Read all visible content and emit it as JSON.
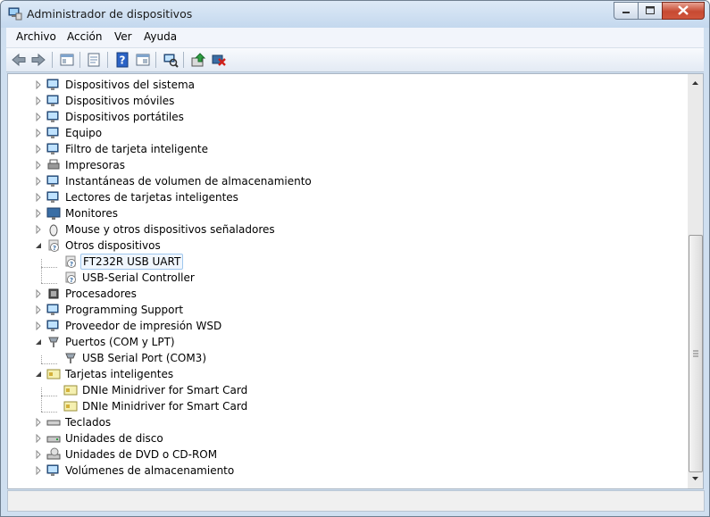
{
  "window": {
    "title": "Administrador de dispositivos"
  },
  "menu": {
    "archivo": "Archivo",
    "accion": "Acción",
    "ver": "Ver",
    "ayuda": "Ayuda"
  },
  "toolbar": {
    "icons": [
      "back-arrow-icon",
      "forward-arrow-icon",
      "show-hide-tree-icon",
      "properties-icon",
      "help-icon",
      "view-icon",
      "scan-hardware-icon",
      "update-driver-icon",
      "uninstall-device-icon"
    ]
  },
  "tree": {
    "items": [
      {
        "label": "Dispositivos del sistema",
        "expanded": false,
        "icon": "system-devices-icon"
      },
      {
        "label": "Dispositivos móviles",
        "expanded": false,
        "icon": "mobile-devices-icon"
      },
      {
        "label": "Dispositivos portátiles",
        "expanded": false,
        "icon": "portable-devices-icon"
      },
      {
        "label": "Equipo",
        "expanded": false,
        "icon": "computer-icon"
      },
      {
        "label": "Filtro de tarjeta inteligente",
        "expanded": false,
        "icon": "smartcard-filter-icon"
      },
      {
        "label": "Impresoras",
        "expanded": false,
        "icon": "printer-icon"
      },
      {
        "label": "Instantáneas de volumen de almacenamiento",
        "expanded": false,
        "icon": "volume-snapshot-icon"
      },
      {
        "label": "Lectores de tarjetas inteligentes",
        "expanded": false,
        "icon": "smartcard-reader-icon"
      },
      {
        "label": "Monitores",
        "expanded": false,
        "icon": "monitor-icon"
      },
      {
        "label": "Mouse y otros dispositivos señaladores",
        "expanded": false,
        "icon": "mouse-icon"
      },
      {
        "label": "Otros dispositivos",
        "expanded": true,
        "icon": "unknown-device-icon"
      },
      {
        "label": "FT232R USB UART",
        "child": true,
        "selected": true,
        "icon": "unknown-device-icon"
      },
      {
        "label": "USB-Serial Controller",
        "child": true,
        "icon": "unknown-device-icon"
      },
      {
        "label": "Procesadores",
        "expanded": false,
        "icon": "processor-icon"
      },
      {
        "label": "Programming Support",
        "expanded": false,
        "icon": "programming-support-icon"
      },
      {
        "label": "Proveedor de impresión WSD",
        "expanded": false,
        "icon": "wsd-printer-icon"
      },
      {
        "label": "Puertos (COM y LPT)",
        "expanded": true,
        "icon": "port-icon"
      },
      {
        "label": "USB Serial Port (COM3)",
        "child": true,
        "icon": "port-icon"
      },
      {
        "label": "Tarjetas inteligentes",
        "expanded": true,
        "icon": "smartcard-icon"
      },
      {
        "label": "DNIe Minidriver for Smart Card",
        "child": true,
        "icon": "smartcard-icon"
      },
      {
        "label": "DNIe Minidriver for Smart Card",
        "child": true,
        "icon": "smartcard-icon"
      },
      {
        "label": "Teclados",
        "expanded": false,
        "icon": "keyboard-icon"
      },
      {
        "label": "Unidades de disco",
        "expanded": false,
        "icon": "disk-drive-icon"
      },
      {
        "label": "Unidades de DVD o CD-ROM",
        "expanded": false,
        "icon": "dvd-drive-icon"
      },
      {
        "label": "Volúmenes de almacenamiento",
        "expanded": false,
        "icon": "storage-volume-icon"
      }
    ]
  },
  "colors": {
    "selection_bg": "#f0f6fd",
    "selection_border": "#9fc7ee",
    "close_button": "#c74a32"
  }
}
